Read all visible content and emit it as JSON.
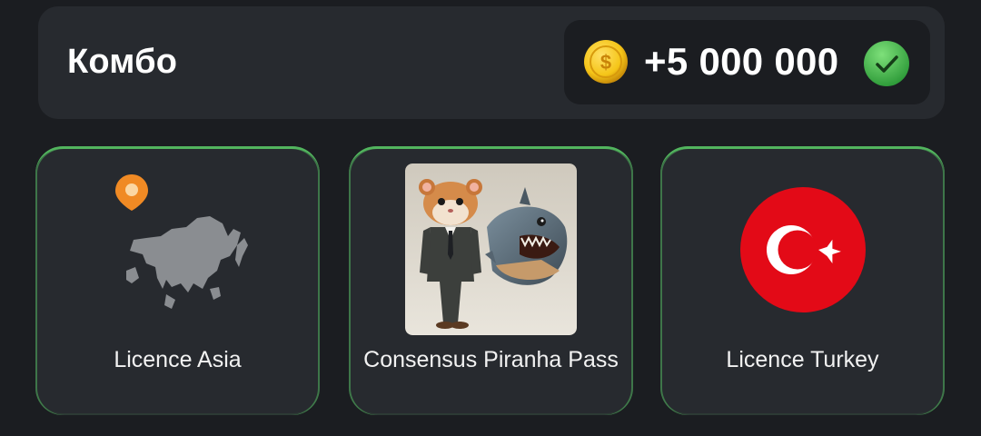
{
  "combo": {
    "title": "Комбо",
    "reward": "+5 000 000",
    "coin_icon": "dollar-coin-icon",
    "status_icon": "check-circle-icon",
    "colors": {
      "accent_green": "#52b55e",
      "coin_gold": "#f5c518"
    }
  },
  "cards": [
    {
      "label": "Licence Asia",
      "image": "asia-map-with-pin-icon"
    },
    {
      "label": "Consensus Piranha Pass",
      "image": "hamster-and-piranha-picture"
    },
    {
      "label": "Licence Turkey",
      "image": "turkey-flag-icon"
    }
  ]
}
